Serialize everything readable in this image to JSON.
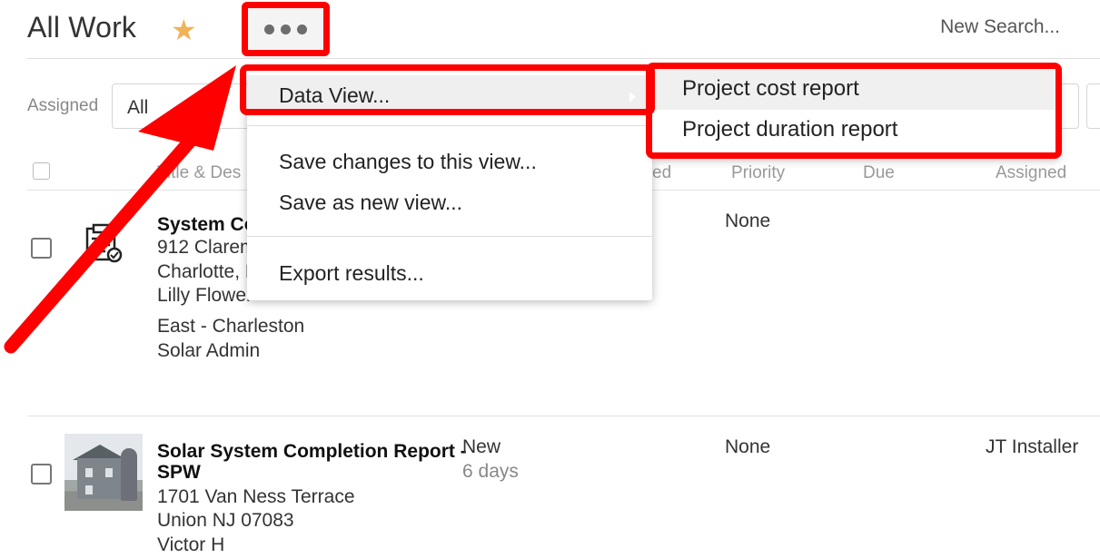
{
  "header": {
    "title": "All Work",
    "star_icon": "★",
    "more_icon": "ellipsis-horizontal",
    "search_link": "New Search..."
  },
  "filters": {
    "assigned_label": "Assigned",
    "assigned_value": "All"
  },
  "table": {
    "columns": {
      "title": "Title & Des",
      "status_partial": "ed",
      "priority": "Priority",
      "due": "Due",
      "assigned": "Assigned"
    },
    "rows": [
      {
        "title": "System Co",
        "address1": "912 Clarem",
        "address2": "Charlotte, N",
        "contact": "Lilly Flower",
        "region": "East - Charleston",
        "role": "Solar Admin",
        "priority": "None",
        "icon": "clipboard-check-icon"
      },
      {
        "title_line1": "Solar System Completion Report -",
        "title_line2": "SPW",
        "address1": "1701 Van Ness Terrace",
        "address2": "Union NJ 07083",
        "contact": "Victor H",
        "status": "New",
        "age": "6 days",
        "priority": "None",
        "assignee": "JT Installer",
        "icon": "house-photo"
      }
    ]
  },
  "menu": {
    "data_view": "Data View...",
    "save_changes": "Save changes to this view...",
    "save_new": "Save as new view...",
    "export": "Export results...",
    "submenu": [
      "Project cost report",
      "Project duration report"
    ]
  },
  "annotation": {
    "color": "#ff0000"
  }
}
